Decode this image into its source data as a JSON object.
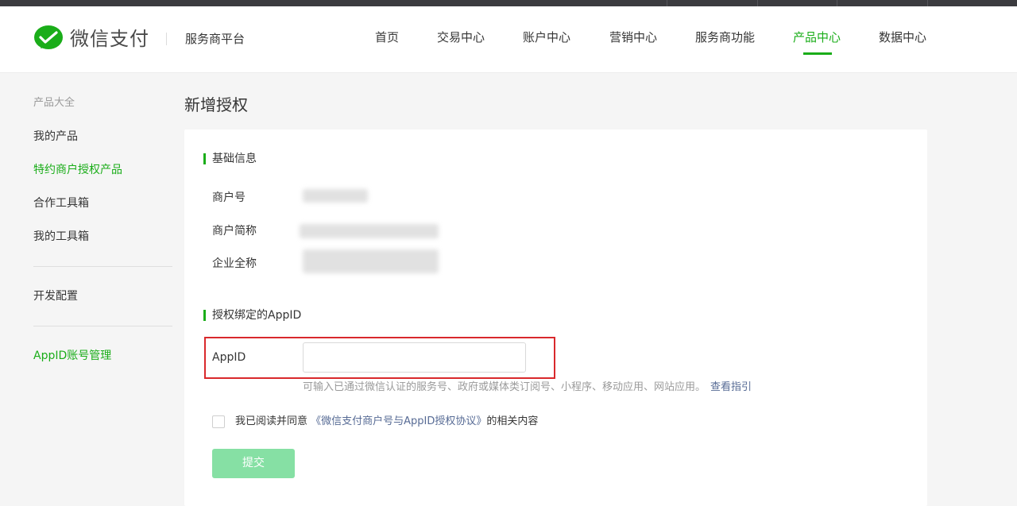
{
  "header": {
    "brand": "微信支付",
    "platform": "服务商平台",
    "nav": [
      {
        "label": "首页"
      },
      {
        "label": "交易中心"
      },
      {
        "label": "账户中心"
      },
      {
        "label": "营销中心"
      },
      {
        "label": "服务商功能"
      },
      {
        "label": "产品中心",
        "active": true
      },
      {
        "label": "数据中心"
      }
    ]
  },
  "sidebar": {
    "heading": "产品大全",
    "items": [
      {
        "label": "我的产品"
      },
      {
        "label": "特约商户授权产品",
        "active": true
      },
      {
        "label": "合作工具箱"
      },
      {
        "label": "我的工具箱"
      },
      {
        "label": "开发配置"
      },
      {
        "label": "AppID账号管理",
        "active": true
      }
    ]
  },
  "page": {
    "title": "新增授权",
    "basic_section": {
      "title": "基础信息",
      "fields": [
        {
          "label": "商户号"
        },
        {
          "label": "商户简称"
        },
        {
          "label": "企业全称"
        }
      ]
    },
    "appid_section": {
      "title": "授权绑定的AppID",
      "field_label": "AppID",
      "input_value": "",
      "input_placeholder": "",
      "hint": "可输入已通过微信认证的服务号、政府或媒体类订阅号、小程序、移动应用、网站应用。",
      "hint_link": "查看指引"
    },
    "agreement": {
      "prefix": "我已阅读并同意",
      "link": "《微信支付商户号与AppID授权协议》",
      "suffix": "的相关内容",
      "checked": false
    },
    "submit_label": "提交"
  },
  "colors": {
    "accent": "#1aad19",
    "link": "#576b95",
    "submit_disabled": "#86e0a4",
    "highlight": "#d9292c"
  }
}
